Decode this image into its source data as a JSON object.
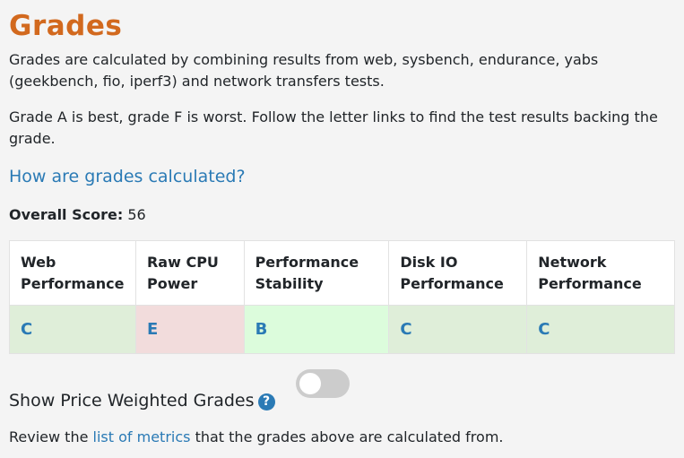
{
  "title": "Grades",
  "intro": "Grades are calculated by combining results from web, sysbench, endurance, yabs (geekbench, fio, iperf3) and network transfers tests.",
  "explanation": "Grade A is best, grade F is worst. Follow the letter links to find the test results backing the grade.",
  "how_link": "How are grades calculated?",
  "overall": {
    "label": "Overall Score:",
    "value": "56"
  },
  "table": {
    "headers": [
      "Web Performance",
      "Raw CPU Power",
      "Performance Stability",
      "Disk IO Performance",
      "Network Performance"
    ],
    "grades": [
      {
        "letter": "C",
        "bg": "#dfeed9"
      },
      {
        "letter": "E",
        "bg": "#f2dcdc"
      },
      {
        "letter": "B",
        "bg": "#dcfcdc"
      },
      {
        "letter": "C",
        "bg": "#dfeed9"
      },
      {
        "letter": "C",
        "bg": "#dfeed9"
      }
    ]
  },
  "price_weighted": {
    "label": "Show Price Weighted Grades",
    "help_icon": "question-circle-icon",
    "enabled": false
  },
  "review": {
    "prefix": "Review the",
    "link": "list of metrics",
    "suffix": "that the grades above are calculated from."
  },
  "colors": {
    "title": "#d2691e",
    "link": "#2a7ab5",
    "toggle_off": "#cccccc"
  }
}
